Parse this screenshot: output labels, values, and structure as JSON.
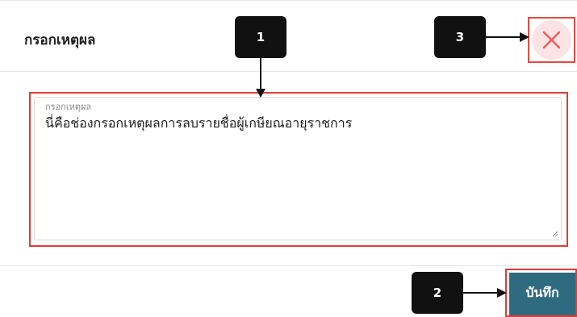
{
  "dialog": {
    "title": "กรอกเหตุผล",
    "reason_label": "กรอกเหตุผล",
    "reason_value": "นี่คือช่องกรอกเหตุผลการลบรายชื่อผู้เกษียณอายุราชการ",
    "save_label": "บันทึก",
    "close_icon": "close-icon"
  },
  "markers": [
    {
      "label": "1"
    },
    {
      "label": "2"
    },
    {
      "label": "3"
    }
  ],
  "colors": {
    "save_button": "#2f6b80",
    "highlight_border": "#e23b33",
    "close_background": "#fde3e3",
    "close_icon": "#e55b5b",
    "marker_background": "#111111"
  }
}
